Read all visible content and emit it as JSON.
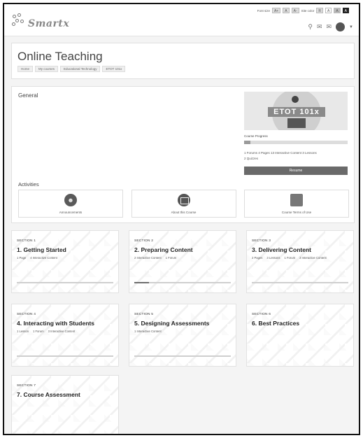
{
  "logo": {
    "text": "Smartx"
  },
  "accessibility": {
    "font_label": "Font size",
    "font_buttons": [
      "A+",
      "A",
      "A-"
    ],
    "color_label": "Site color",
    "color_buttons": [
      "R",
      "A",
      "A",
      "A"
    ]
  },
  "page": {
    "title": "Online Teaching",
    "breadcrumbs": [
      "Home",
      "My courses",
      "Educational Technology",
      "ETOT 101x"
    ]
  },
  "general": {
    "title": "General",
    "course_banner": "ETOT 101x",
    "progress_label": "Course Progress",
    "progress": 0.06,
    "meta_line1": "1 Forums  4 Pages  13 Interactive Content  3 Lessons",
    "meta_line2": "2 Quizzes",
    "resume": "Resume",
    "activities_title": "Activities",
    "activities": [
      {
        "label": "Announcements",
        "icon": "people-icon"
      },
      {
        "label": "About this Course",
        "icon": "window-icon"
      },
      {
        "label": "Course Terms of Use",
        "icon": "document-icon"
      }
    ]
  },
  "sections": [
    {
      "num": "SECTION 1",
      "title": "1. Getting Started",
      "stats": [
        "1 Page",
        "4 Interactive Content"
      ],
      "progress": 0
    },
    {
      "num": "SECTION 2",
      "title": "2. Preparing Content",
      "stats": [
        "2 Interactive Content",
        "1 Forum"
      ],
      "progress": 0.15
    },
    {
      "num": "SECTION 3",
      "title": "3. Delivering Content",
      "stats": [
        "2 Pages",
        "3 Lessons",
        "1 Forum",
        "3 Interactive Content"
      ],
      "progress": 0
    },
    {
      "num": "SECTION 4",
      "title": "4. Interacting with Students",
      "stats": [
        "1 Lesson",
        "1 Forum",
        "3 Interactive Content"
      ],
      "progress": 0
    },
    {
      "num": "SECTION 5",
      "title": "5. Designing Assessments",
      "stats": [
        "1 Interactive Content"
      ],
      "progress": 0
    },
    {
      "num": "SECTION 6",
      "title": "6. Best Practices",
      "stats": [],
      "progress": 0
    },
    {
      "num": "SECTION 7",
      "title": "7. Course Assessment",
      "stats": [],
      "progress": 0
    }
  ],
  "colors": {
    "accent": "#6a6a6a",
    "background": "#f4f4f4"
  }
}
